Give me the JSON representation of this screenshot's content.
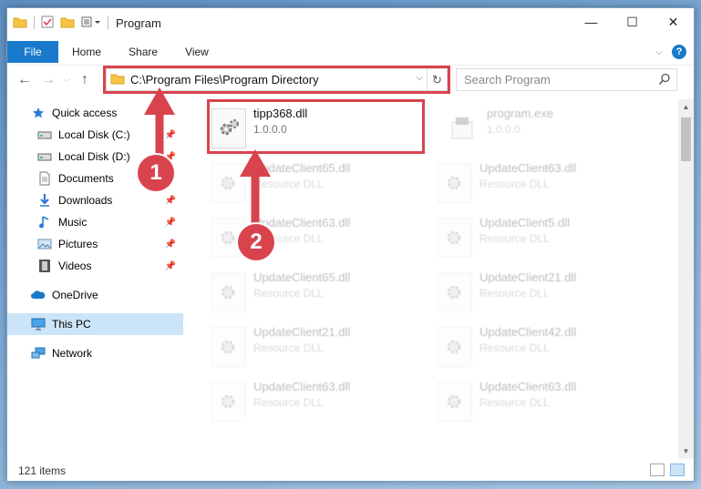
{
  "window": {
    "title": "Program"
  },
  "window_controls": {
    "minimize": "—",
    "maximize": "☐",
    "close": "✕"
  },
  "ribbon": {
    "file_tab": "File",
    "tabs": [
      "Home",
      "Share",
      "View"
    ],
    "help": "?"
  },
  "address": {
    "path": "C:\\Program Files\\Program Directory"
  },
  "search": {
    "placeholder": "Search Program"
  },
  "nav": {
    "quick_access": "Quick access",
    "items": [
      {
        "label": "Local Disk (C:)"
      },
      {
        "label": "Local Disk (D:)"
      },
      {
        "label": "Documents"
      },
      {
        "label": "Downloads"
      },
      {
        "label": "Music"
      },
      {
        "label": "Pictures"
      },
      {
        "label": "Videos"
      }
    ],
    "onedrive": "OneDrive",
    "this_pc": "This PC",
    "network": "Network"
  },
  "files": {
    "highlighted": {
      "name": "tipp368.dll",
      "desc": "1.0.0.0"
    },
    "program_exe": {
      "name": "program.exe",
      "desc": "1.0.0.0"
    },
    "grid": [
      {
        "name": "UpdateClient65.dll",
        "desc": "Resource DLL"
      },
      {
        "name": "UpdateClient63.dll",
        "desc": "Resource DLL"
      },
      {
        "name": "UpdateClient63.dll",
        "desc": "Resource DLL"
      },
      {
        "name": "UpdateClient5.dll",
        "desc": "Resource DLL"
      },
      {
        "name": "UpdateClient65.dll",
        "desc": "Resource DLL"
      },
      {
        "name": "UpdateClient21.dll",
        "desc": "Resource DLL"
      },
      {
        "name": "UpdateClient21.dll",
        "desc": "Resource DLL"
      },
      {
        "name": "UpdateClient42.dll",
        "desc": "Resource DLL"
      },
      {
        "name": "UpdateClient63.dll",
        "desc": "Resource DLL"
      },
      {
        "name": "UpdateClient63.dll",
        "desc": "Resource DLL"
      }
    ]
  },
  "status": {
    "item_count": "121 items"
  },
  "annotations": {
    "badge1": "1",
    "badge2": "2",
    "color": "#d9434e"
  }
}
